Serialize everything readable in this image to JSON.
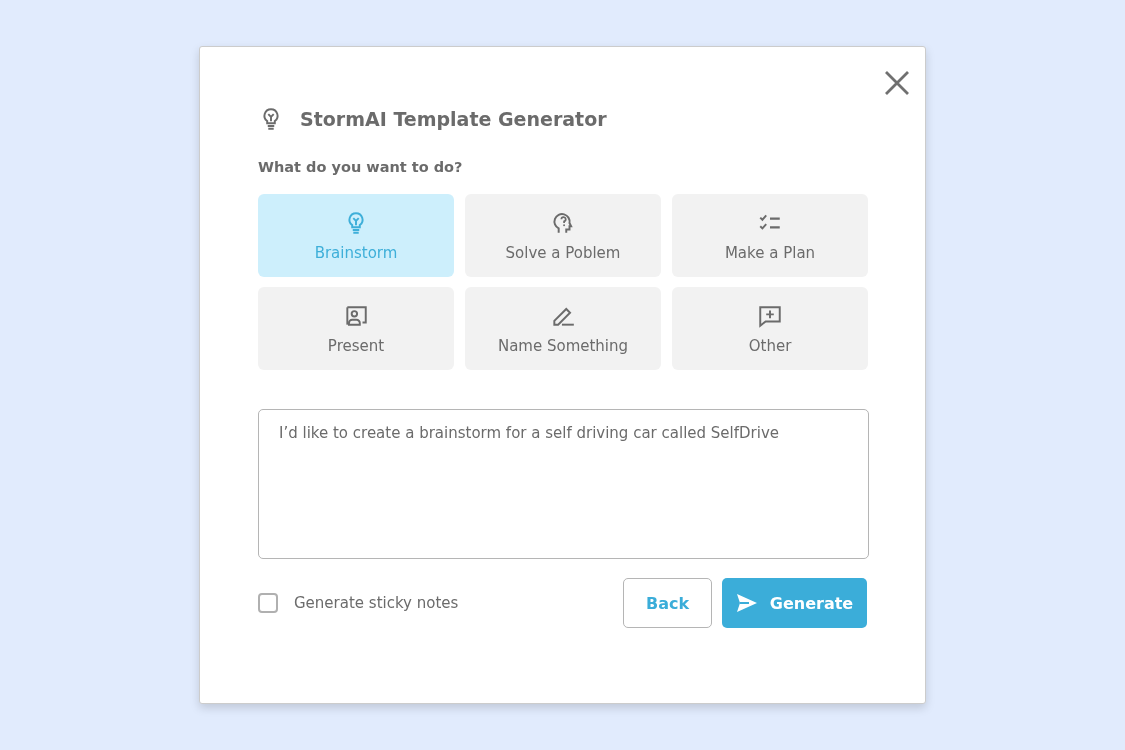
{
  "dialog": {
    "title": "StormAI Template Generator",
    "question": "What do you want to do?",
    "options": [
      {
        "label": "Brainstorm",
        "kind": "bulb",
        "selected": true
      },
      {
        "label": "Solve a Poblem",
        "kind": "head",
        "selected": false
      },
      {
        "label": "Make a Plan",
        "kind": "checklist",
        "selected": false
      },
      {
        "label": "Present",
        "kind": "presenter",
        "selected": false
      },
      {
        "label": "Name Something",
        "kind": "pencil",
        "selected": false
      },
      {
        "label": "Other",
        "kind": "comment",
        "selected": false
      }
    ],
    "prompt": {
      "value": "I’d like to create a brainstorm for a self driving car called SelfDrive"
    },
    "sticky_notes": {
      "label": "Generate sticky notes",
      "checked": false
    },
    "buttons": [
      {
        "label": "Back",
        "kind": "secondary"
      },
      {
        "label": "Generate",
        "kind": "primary"
      }
    ]
  }
}
